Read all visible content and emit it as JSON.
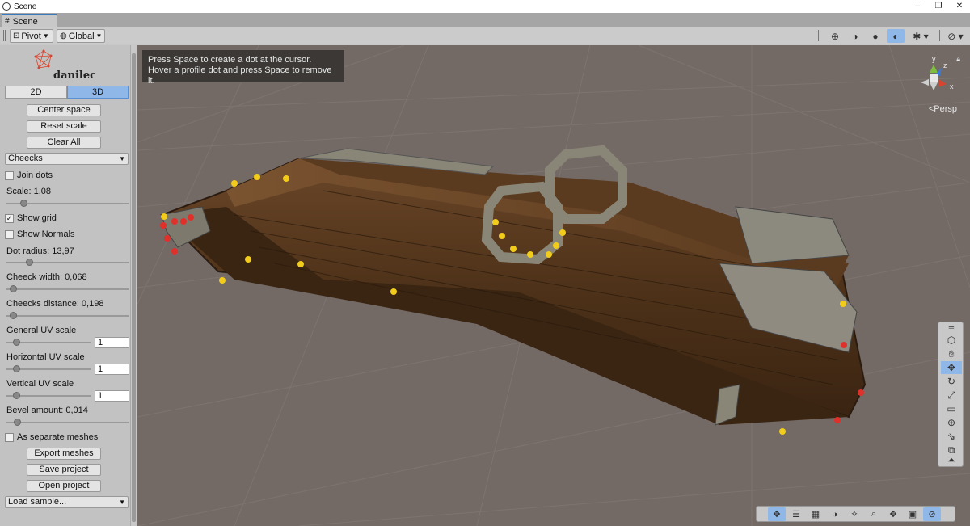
{
  "window": {
    "title": "Scene",
    "controls": [
      "–",
      "❐",
      "✕"
    ]
  },
  "tab": {
    "label": "Scene"
  },
  "toolbar": {
    "pivot_label": "Pivot",
    "global_label": "Global"
  },
  "panel": {
    "mode_2d": "2D",
    "mode_3d": "3D",
    "mode_selected": "3D",
    "center_space": "Center space",
    "reset_scale": "Reset scale",
    "clear_all": "Clear All",
    "profile_select": "Cheecks",
    "join_dots": {
      "label": "Join dots",
      "checked": false
    },
    "scale": {
      "label": "Scale: 1,08",
      "level": 0.12
    },
    "show_grid": {
      "label": "Show grid",
      "checked": true
    },
    "show_normals": {
      "label": "Show Normals",
      "checked": false
    },
    "dot_radius": {
      "label": "Dot radius: 13,97",
      "level": 0.17
    },
    "cheeck_width": {
      "label": "Cheeck width: 0,068",
      "level": 0.03
    },
    "cheecks_distance": {
      "label": "Cheecks distance: 0,198",
      "level": 0.03
    },
    "general_uv": {
      "label": "General UV scale",
      "value": "1",
      "level": 0.08
    },
    "horizontal_uv": {
      "label": "Horizontal UV scale",
      "value": "1",
      "level": 0.08
    },
    "vertical_uv": {
      "label": "Vertical UV scale",
      "value": "1",
      "level": 0.08
    },
    "bevel": {
      "label": "Bevel amount: 0,014",
      "level": 0.06
    },
    "separate_meshes": {
      "label": "As separate meshes",
      "checked": false
    },
    "export_meshes": "Export meshes",
    "save_project": "Save project",
    "open_project": "Open project",
    "load_sample": "Load sample..."
  },
  "viewport": {
    "hint_line1": "Press Space to create a dot at the cursor.",
    "hint_line2": "Hover a profile dot and press Space to remove it.",
    "projection": "<Persp",
    "gizmo": {
      "x": "x",
      "y": "y",
      "z": "z"
    }
  },
  "colors": {
    "accent": "#8fb8e8",
    "dot_yellow": "#f2cc1a",
    "dot_red": "#e0302a",
    "viewport_bg": "#736a66"
  }
}
